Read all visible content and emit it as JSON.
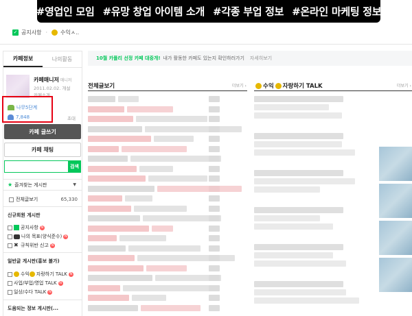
{
  "banner": {
    "tags": [
      "#영업인 모임",
      "#유망 창업 아이템 소개",
      "#각종 부업 정보",
      "#온라인 마케팅 정보"
    ]
  },
  "quick_menu": {
    "item1": "공지사항",
    "item2": "수익ㅅ.."
  },
  "sidebar": {
    "tab_cafe_info": "카페정보",
    "tab_my_activity": "나의활동",
    "manager_name": "카페매니저",
    "manager_tag": "매니저",
    "since": "2011.02.02. 개설",
    "intro": "카페소개",
    "level": "나무5단계",
    "members": "7,848",
    "invite": "초대",
    "write_button": "카페 글쓰기",
    "chat_button": "카페 채팅",
    "search_button": "검색",
    "favorites": "즐겨찾는 게시판",
    "all_posts": "전체글보기",
    "all_posts_count": "65,330",
    "section_new": "신규회원 게시판",
    "new_items": [
      "공지사항",
      "나의 목표(양식준수)",
      "규칙위반 신고"
    ],
    "section_general": "일반글 게시판(홍보 불가)",
    "general_items": [
      "수익",
      "자랑하기 TALK",
      "사업/부업/영업 TALK",
      "일상/수다 TALK"
    ],
    "section_useful": "도움되는 정보 게시판(..."
  },
  "main": {
    "notice_green": "10월 카플리 선정 카페 대중개!",
    "notice_gray": "내가 활동한 카페도 있는지 확인하러가기",
    "notice_more": "자세히보기",
    "left_title": "전체글보기",
    "left_more": "더보기",
    "right_title": "수익",
    "right_title_suffix": "자랑하기 TALK",
    "right_more": "더보기"
  },
  "colors": {
    "accent_green": "#03c75a",
    "highlight_red": "#e60012",
    "banner_bg": "#000000",
    "blur_pink": "#f4c7c9",
    "blur_gray": "#dcdcdc"
  }
}
